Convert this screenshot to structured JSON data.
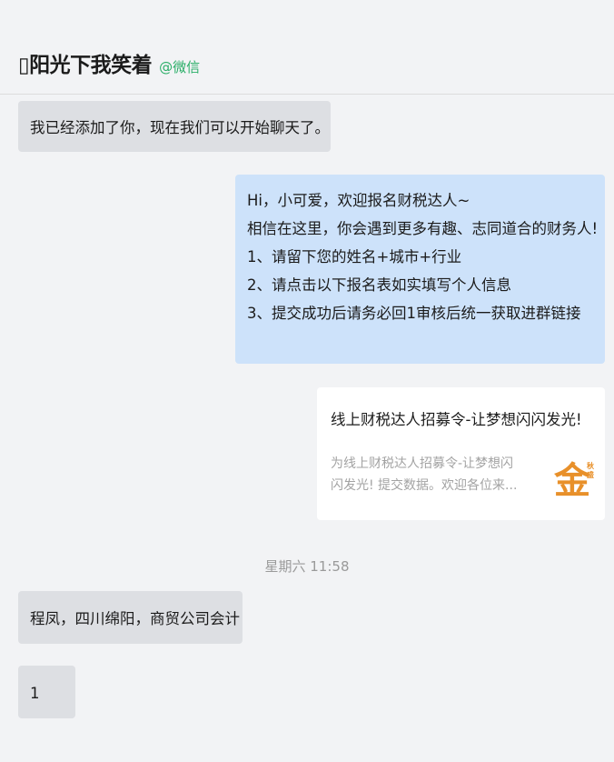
{
  "header": {
    "contact_name": "▯阳光下我笑着",
    "contact_source": "@微信"
  },
  "messages": {
    "msg1": "我已经添加了你，现在我们可以开始聊天了。",
    "msg2_lines": [
      "Hi，小可爱，欢迎报名财税达人~",
      "相信在这里，你会遇到更多有趣、志同道合的财务人!",
      "1、请留下您的姓名+城市+行业",
      "2、请点击以下报名表如实填写个人信息",
      "3、提交成功后请务必回1审核后统一获取进群链接"
    ],
    "link_card": {
      "title": "线上财税达人招募令-让梦想闪闪发光!",
      "desc_line1": "为线上财税达人招募令-让梦想闪",
      "desc_line2": "闪发光! 提交数据。欢迎各位来...",
      "thumb_char": "金",
      "thumb_strip": "秋盛"
    },
    "timestamp": "星期六 11:58",
    "msg3": "程凤，四川绵阳，商贸公司会计",
    "msg4": "1"
  },
  "colors": {
    "page_background": "#f2f3f5",
    "incoming_bubble": "#dddfe3",
    "outgoing_bubble": "#cde2fa",
    "source_tag": "#2aae67",
    "timestamp": "#9a9a9a"
  }
}
